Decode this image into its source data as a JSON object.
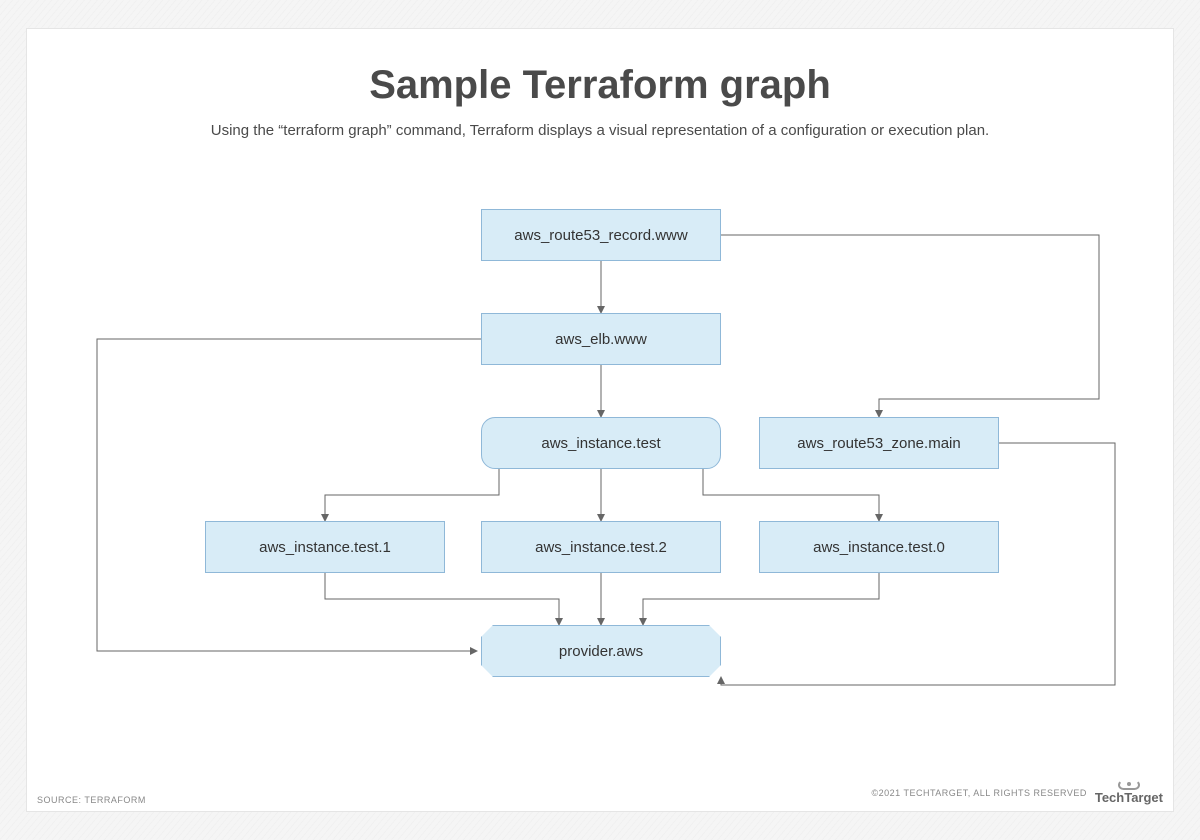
{
  "title": "Sample Terraform graph",
  "subtitle": "Using the “terraform graph” command, Terraform displays a visual representation of a configuration or execution plan.",
  "nodes": {
    "route53_record": "aws_route53_record.www",
    "elb": "aws_elb.www",
    "instance_test": "aws_instance.test",
    "route53_zone": "aws_route53_zone.main",
    "instance_test_1": "aws_instance.test.1",
    "instance_test_2": "aws_instance.test.2",
    "instance_test_0": "aws_instance.test.0",
    "provider": "provider.aws"
  },
  "edges": [
    {
      "from": "route53_record",
      "to": "elb"
    },
    {
      "from": "route53_record",
      "to": "route53_zone"
    },
    {
      "from": "elb",
      "to": "instance_test"
    },
    {
      "from": "elb",
      "to": "provider"
    },
    {
      "from": "instance_test",
      "to": "instance_test_1"
    },
    {
      "from": "instance_test",
      "to": "instance_test_2"
    },
    {
      "from": "instance_test",
      "to": "instance_test_0"
    },
    {
      "from": "instance_test_1",
      "to": "provider"
    },
    {
      "from": "instance_test_2",
      "to": "provider"
    },
    {
      "from": "instance_test_0",
      "to": "provider"
    },
    {
      "from": "route53_zone",
      "to": "provider"
    }
  ],
  "footer": {
    "source": "SOURCE: TERRAFORM",
    "copyright": "©2021 TECHTARGET, ALL RIGHTS RESERVED",
    "brand": "TechTarget"
  }
}
